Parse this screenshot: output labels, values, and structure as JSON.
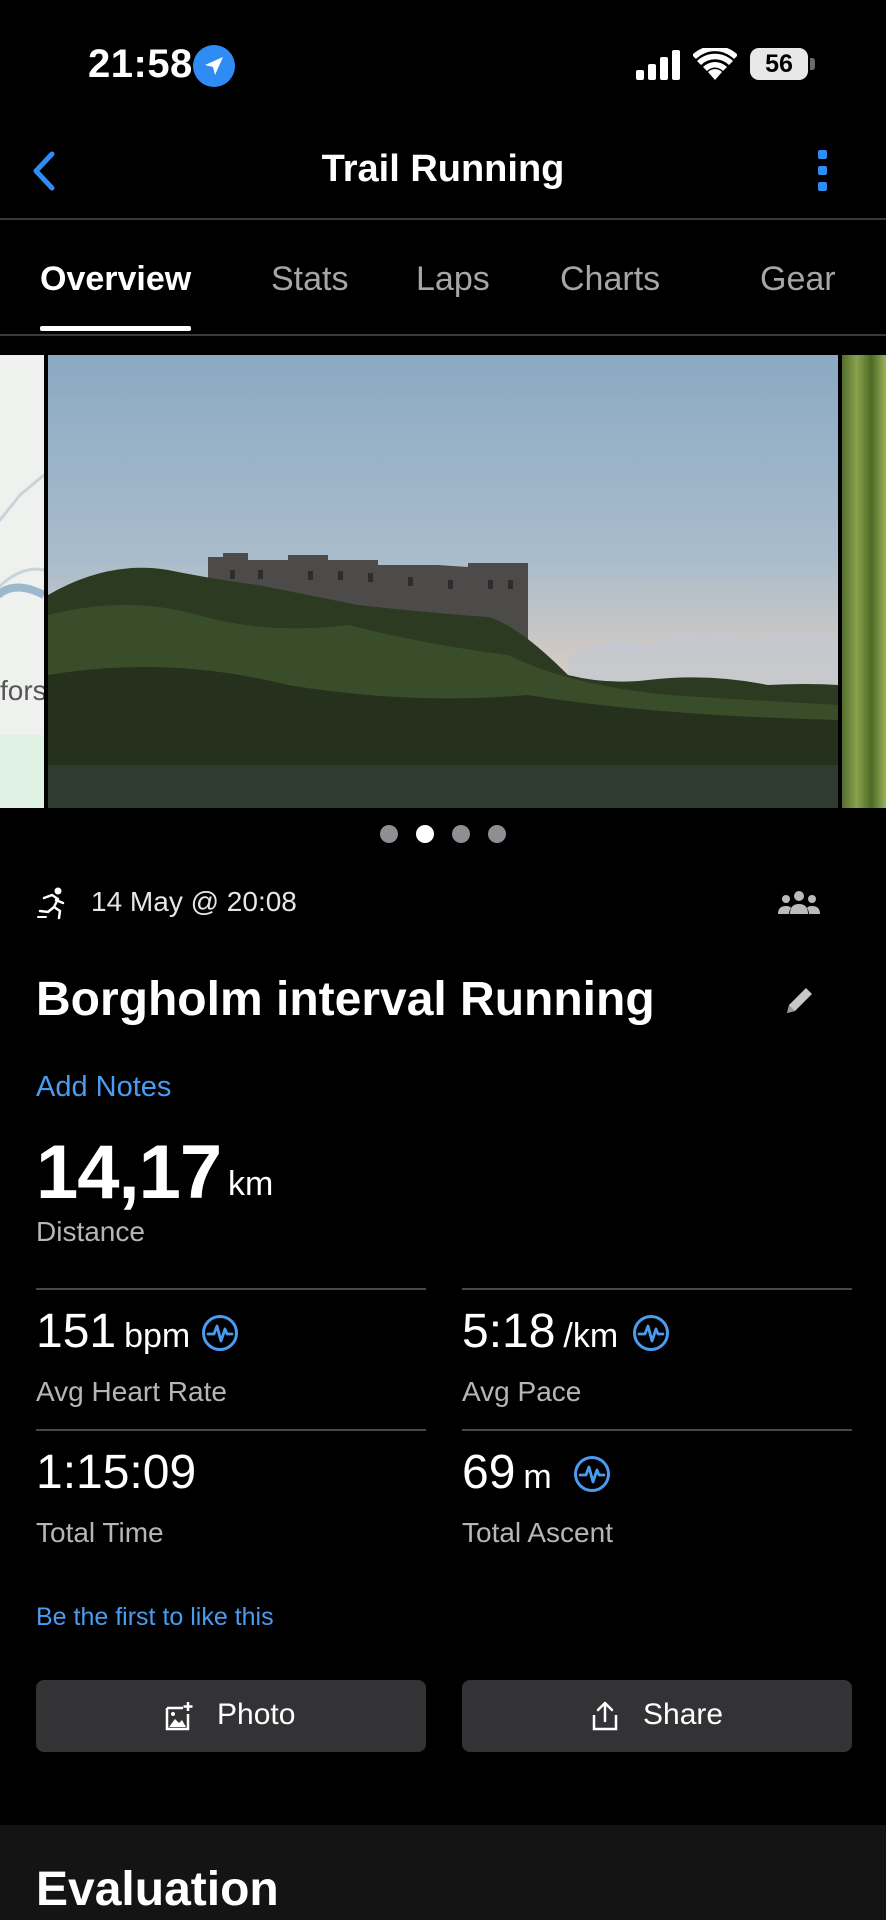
{
  "status_bar": {
    "time": "21:58",
    "battery": "56"
  },
  "header": {
    "title": "Trail Running"
  },
  "tabs": [
    {
      "label": "Overview",
      "active": true
    },
    {
      "label": "Stats"
    },
    {
      "label": "Laps"
    },
    {
      "label": "Charts"
    },
    {
      "label": "Gear"
    }
  ],
  "carousel": {
    "map_text": "fors",
    "page_count": 4,
    "active_page": 2
  },
  "activity": {
    "date": "14 May @ 20:08",
    "name": "Borgholm interval Running",
    "add_notes": "Add Notes"
  },
  "distance": {
    "value": "14,17",
    "unit": "km",
    "label": "Distance"
  },
  "stats": {
    "heart_rate": {
      "value": "151",
      "unit": "bpm",
      "label": "Avg Heart Rate"
    },
    "pace": {
      "value": "5:18",
      "unit": "/km",
      "label": "Avg Pace"
    },
    "time": {
      "value": "1:15:09",
      "label": "Total Time"
    },
    "ascent": {
      "value": "69",
      "unit": "m",
      "label": "Total Ascent"
    }
  },
  "social": {
    "like_text": "Be the first to like this"
  },
  "actions": {
    "photo_label": "Photo",
    "share_label": "Share"
  },
  "evaluation": {
    "title": "Evaluation"
  },
  "colors": {
    "accent": "#2f8cf5",
    "link": "#4a9cf0",
    "background": "#000000"
  }
}
